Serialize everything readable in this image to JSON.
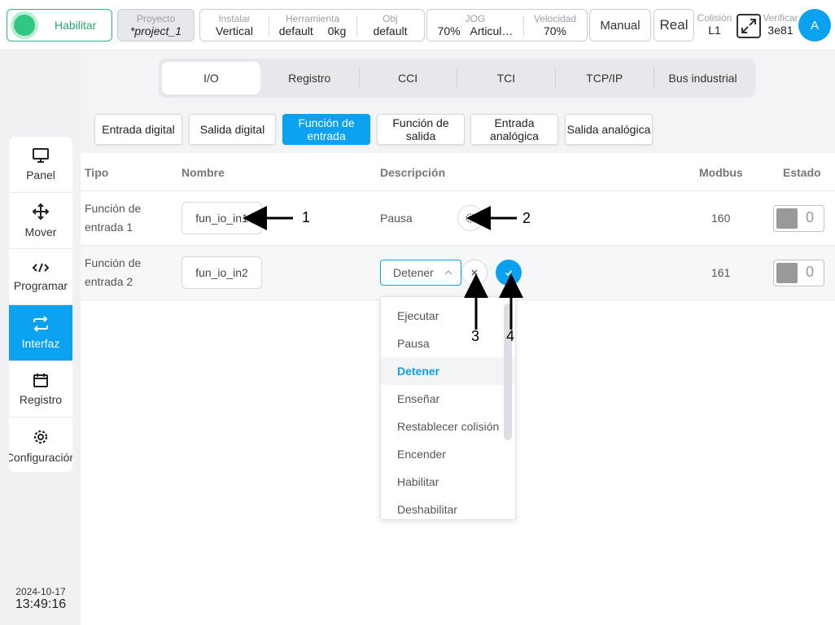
{
  "topbar": {
    "enable_label": "Habilitar",
    "project": {
      "label": "Proyecto",
      "value": "*project_1"
    },
    "install": {
      "label": "Instalar",
      "value": "Vertical"
    },
    "tool": {
      "label": "Herramienta",
      "value": "default",
      "weight": "0kg"
    },
    "obj": {
      "label": "Obj",
      "value": "default"
    },
    "jog": {
      "label": "JOG",
      "value": "70%",
      "mode": "Articul…"
    },
    "speed": {
      "label": "Velocidad",
      "value": "70%"
    },
    "mode": "Manual",
    "real": "Real",
    "collision": {
      "label": "Colisión",
      "value": "L1"
    },
    "verify": {
      "label": "Verificar",
      "value": "3e81"
    },
    "avatar": "A"
  },
  "sidebar": {
    "items": [
      {
        "label": "Panel",
        "icon": "monitor-icon"
      },
      {
        "label": "Mover",
        "icon": "move-icon"
      },
      {
        "label": "Programar",
        "icon": "code-icon"
      },
      {
        "label": "Interfaz",
        "icon": "swap-icon"
      },
      {
        "label": "Registro",
        "icon": "calendar-icon"
      },
      {
        "label": "Configuración",
        "icon": "gear-icon"
      }
    ],
    "active_index": 3,
    "date": "2024-10-17",
    "time": "13:49:16"
  },
  "tabs": [
    "I/O",
    "Registro",
    "CCI",
    "TCI",
    "TCP/IP",
    "Bus industrial"
  ],
  "subtabs": [
    "Entrada digital",
    "Salida digital",
    "Función de entrada",
    "Función de salida",
    "Entrada analógica",
    "Salida analógica"
  ],
  "table": {
    "headers": {
      "type": "Tipo",
      "name": "Nombre",
      "desc": "Descripción",
      "modbus": "Modbus",
      "state": "Estado"
    },
    "rows": [
      {
        "type": "Función de entrada 1",
        "name": "fun_io_in1",
        "desc": "Pausa",
        "modbus": "160",
        "state": "0"
      },
      {
        "type": "Función de entrada 2",
        "name": "fun_io_in2",
        "desc": "Detener",
        "modbus": "161",
        "state": "0"
      }
    ]
  },
  "dropdown": {
    "options": [
      "Ejecutar",
      "Pausa",
      "Detener",
      "Enseñar",
      "Restablecer colisión",
      "Encender",
      "Habilitar",
      "Deshabilitar"
    ],
    "selected": "Detener"
  },
  "annotations": [
    "1",
    "2",
    "3",
    "4"
  ],
  "colors": {
    "accent": "#0aa1f0",
    "enable_green": "#2fc781"
  }
}
